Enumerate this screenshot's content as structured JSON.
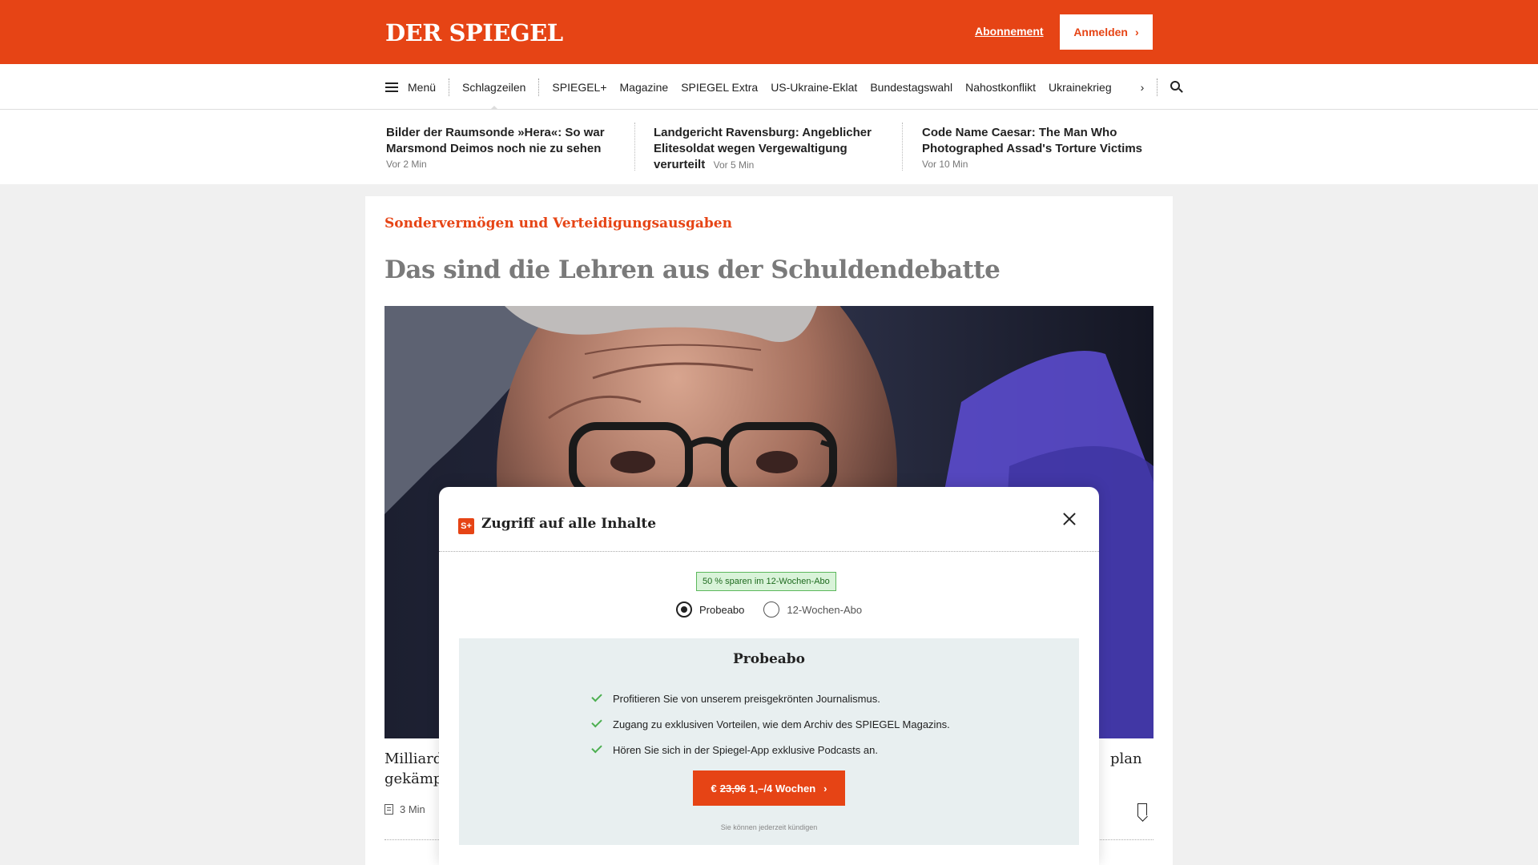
{
  "header": {
    "logo": "DER SPIEGEL",
    "subscription_link": "Abonnement",
    "login_button": "Anmelden",
    "brand_color": "#e64415"
  },
  "nav": {
    "menu_label": "Menü",
    "items": [
      "Schlagzeilen",
      "SPIEGEL+",
      "Magazine",
      "SPIEGEL Extra",
      "US-Ukraine-Eklat",
      "Bundestagswahl",
      "Nahostkonflikt",
      "Ukrainekrieg"
    ],
    "active_item": "Schlagzeilen"
  },
  "teasers": [
    {
      "title": "Bilder der Raumsonde »Hera«: So war Marsmond Deimos noch nie zu sehen",
      "time": "Vor 2 Min"
    },
    {
      "title": "Landgericht Ravensburg: Angeblicher Elitesoldat wegen Vergewaltigung verurteilt",
      "time": "Vor 5 Min"
    },
    {
      "title": "Code Name Caesar: The Man Who Photographed Assad's Torture Victims",
      "time": "Vor 10 Min"
    }
  ],
  "article": {
    "kicker": "Sondervermögen und Verteidigungsausgaben",
    "headline": "Das sind die Lehren aus der Schuldendebatte",
    "teaser_left": "Milliarde\ngekämpf",
    "teaser_right": "plan",
    "reading_time": "3 Min"
  },
  "modal": {
    "title": "Zugriff auf alle Inhalte",
    "icon_text": "S+",
    "save_badge": "50 % sparen im 12-Wochen-Abo",
    "options": [
      "Probeabo",
      "12-Wochen-Abo"
    ],
    "selected_option": "Probeabo",
    "plan_title": "Probeabo",
    "benefits": [
      "Profitieren Sie von unserem preisgekrönten Journalismus.",
      "Zugang zu exklusiven Vorteilen, wie dem Archiv des SPIEGEL Magazins.",
      "Hören Sie sich in der Spiegel-App exklusive Podcasts an."
    ],
    "cta_currency": "€",
    "cta_old_price": "23,96",
    "cta_new_price": "1,–/4 Wochen",
    "fine_print": "Sie können jederzeit kündigen"
  }
}
